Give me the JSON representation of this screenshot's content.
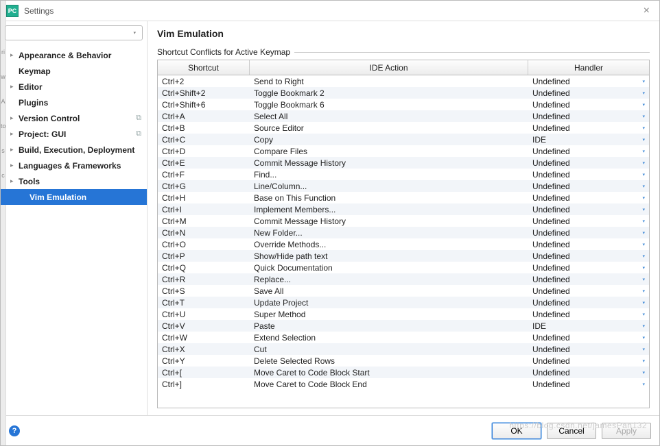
{
  "window": {
    "title": "Settings"
  },
  "search": {
    "placeholder": ""
  },
  "sidebar": {
    "items": [
      {
        "label": "Appearance & Behavior",
        "bold": true,
        "arrow": true
      },
      {
        "label": "Keymap",
        "bold": true
      },
      {
        "label": "Editor",
        "bold": true,
        "arrow": true
      },
      {
        "label": "Plugins",
        "bold": true
      },
      {
        "label": "Version Control",
        "bold": true,
        "arrow": true,
        "copy": true
      },
      {
        "label": "Project: GUI",
        "bold": true,
        "arrow": true,
        "copy": true
      },
      {
        "label": "Build, Execution, Deployment",
        "bold": true,
        "arrow": true
      },
      {
        "label": "Languages & Frameworks",
        "bold": true,
        "arrow": true
      },
      {
        "label": "Tools",
        "bold": true,
        "arrow": true
      },
      {
        "label": "Vim Emulation",
        "bold": true,
        "selected": true,
        "child": true
      }
    ]
  },
  "page": {
    "title": "Vim Emulation",
    "section": "Shortcut Conflicts for Active Keymap",
    "columns": {
      "shortcut": "Shortcut",
      "action": "IDE Action",
      "handler": "Handler"
    },
    "rows": [
      {
        "shortcut": "Ctrl+2",
        "action": "Send to Right",
        "handler": "Undefined"
      },
      {
        "shortcut": "Ctrl+Shift+2",
        "action": "Toggle Bookmark 2",
        "handler": "Undefined"
      },
      {
        "shortcut": "Ctrl+Shift+6",
        "action": "Toggle Bookmark 6",
        "handler": "Undefined"
      },
      {
        "shortcut": "Ctrl+A",
        "action": "Select All",
        "handler": "Undefined"
      },
      {
        "shortcut": "Ctrl+B",
        "action": "Source Editor",
        "handler": "Undefined"
      },
      {
        "shortcut": "Ctrl+C",
        "action": "Copy",
        "handler": "IDE"
      },
      {
        "shortcut": "Ctrl+D",
        "action": "Compare Files",
        "handler": "Undefined"
      },
      {
        "shortcut": "Ctrl+E",
        "action": "Commit Message History",
        "handler": "Undefined"
      },
      {
        "shortcut": "Ctrl+F",
        "action": "Find...",
        "handler": "Undefined"
      },
      {
        "shortcut": "Ctrl+G",
        "action": "Line/Column...",
        "handler": "Undefined"
      },
      {
        "shortcut": "Ctrl+H",
        "action": "Base on This Function",
        "handler": "Undefined"
      },
      {
        "shortcut": "Ctrl+I",
        "action": "Implement Members...",
        "handler": "Undefined"
      },
      {
        "shortcut": "Ctrl+M",
        "action": "Commit Message History",
        "handler": "Undefined"
      },
      {
        "shortcut": "Ctrl+N",
        "action": "New Folder...",
        "handler": "Undefined"
      },
      {
        "shortcut": "Ctrl+O",
        "action": "Override Methods...",
        "handler": "Undefined"
      },
      {
        "shortcut": "Ctrl+P",
        "action": "Show/Hide path text",
        "handler": "Undefined"
      },
      {
        "shortcut": "Ctrl+Q",
        "action": "Quick Documentation",
        "handler": "Undefined"
      },
      {
        "shortcut": "Ctrl+R",
        "action": "Replace...",
        "handler": "Undefined"
      },
      {
        "shortcut": "Ctrl+S",
        "action": "Save All",
        "handler": "Undefined"
      },
      {
        "shortcut": "Ctrl+T",
        "action": "Update Project",
        "handler": "Undefined"
      },
      {
        "shortcut": "Ctrl+U",
        "action": "Super Method",
        "handler": "Undefined"
      },
      {
        "shortcut": "Ctrl+V",
        "action": "Paste",
        "handler": "IDE"
      },
      {
        "shortcut": "Ctrl+W",
        "action": "Extend Selection",
        "handler": "Undefined"
      },
      {
        "shortcut": "Ctrl+X",
        "action": "Cut",
        "handler": "Undefined"
      },
      {
        "shortcut": "Ctrl+Y",
        "action": "Delete Selected Rows",
        "handler": "Undefined"
      },
      {
        "shortcut": "Ctrl+[",
        "action": "Move Caret to Code Block Start",
        "handler": "Undefined"
      },
      {
        "shortcut": "Ctrl+]",
        "action": "Move Caret to Code Block End",
        "handler": "Undefined"
      }
    ]
  },
  "footer": {
    "ok": "OK",
    "cancel": "Cancel",
    "apply": "Apply"
  },
  "gutter": [
    "ri",
    "w",
    "A",
    "to",
    "s",
    "c"
  ],
  "watermark": "https://blog.csdn.net/jamesPan132"
}
